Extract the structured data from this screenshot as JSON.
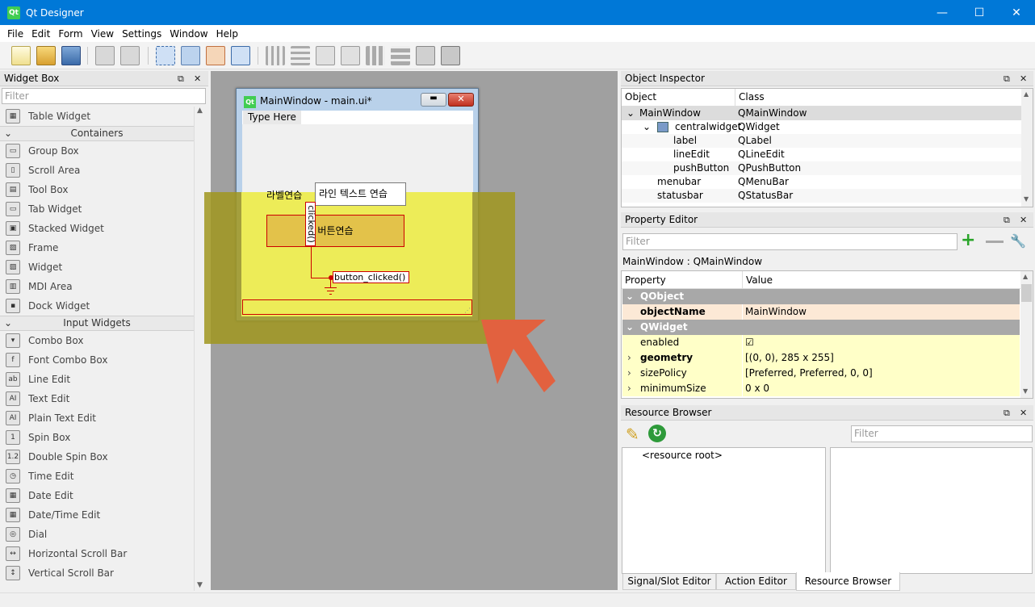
{
  "window": {
    "title": "Qt Designer",
    "app_icon": "Qt",
    "minimize": "—",
    "maximize": "☐",
    "close": "✕"
  },
  "menu": [
    "File",
    "Edit",
    "Form",
    "View",
    "Settings",
    "Window",
    "Help"
  ],
  "toolbar": {
    "icons": [
      "new-file-icon",
      "open-file-icon",
      "save-icon",
      "copy-icon",
      "paste-icon",
      "edit-widgets-icon",
      "edit-signals-slots-icon",
      "edit-buddies-icon",
      "edit-tab-order-icon",
      "layout-horizontal-icon",
      "layout-vertical-icon",
      "layout-h-splitter-icon",
      "layout-v-splitter-icon",
      "layout-grid-icon",
      "layout-form-icon",
      "break-layout-icon",
      "adjust-size-icon"
    ]
  },
  "widget_box": {
    "title": "Widget Box",
    "filter_placeholder": "Filter",
    "items": [
      {
        "type": "item",
        "label": "Table Widget",
        "icon": "▦"
      },
      {
        "type": "cat",
        "label": "Containers"
      },
      {
        "type": "item",
        "label": "Group Box",
        "icon": "▭"
      },
      {
        "type": "item",
        "label": "Scroll Area",
        "icon": "▯"
      },
      {
        "type": "item",
        "label": "Tool Box",
        "icon": "▤"
      },
      {
        "type": "item",
        "label": "Tab Widget",
        "icon": "▭"
      },
      {
        "type": "item",
        "label": "Stacked Widget",
        "icon": "▣"
      },
      {
        "type": "item",
        "label": "Frame",
        "icon": "▨"
      },
      {
        "type": "item",
        "label": "Widget",
        "icon": "▨"
      },
      {
        "type": "item",
        "label": "MDI Area",
        "icon": "▥"
      },
      {
        "type": "item",
        "label": "Dock Widget",
        "icon": "▪"
      },
      {
        "type": "cat",
        "label": "Input Widgets"
      },
      {
        "type": "item",
        "label": "Combo Box",
        "icon": "▾"
      },
      {
        "type": "item",
        "label": "Font Combo Box",
        "icon": "f"
      },
      {
        "type": "item",
        "label": "Line Edit",
        "icon": "ab"
      },
      {
        "type": "item",
        "label": "Text Edit",
        "icon": "AI"
      },
      {
        "type": "item",
        "label": "Plain Text Edit",
        "icon": "AI"
      },
      {
        "type": "item",
        "label": "Spin Box",
        "icon": "1"
      },
      {
        "type": "item",
        "label": "Double Spin Box",
        "icon": "1.2"
      },
      {
        "type": "item",
        "label": "Time Edit",
        "icon": "◷"
      },
      {
        "type": "item",
        "label": "Date Edit",
        "icon": "▦"
      },
      {
        "type": "item",
        "label": "Date/Time Edit",
        "icon": "▦"
      },
      {
        "type": "item",
        "label": "Dial",
        "icon": "◎"
      },
      {
        "type": "item",
        "label": "Horizontal Scroll Bar",
        "icon": "↔"
      },
      {
        "type": "item",
        "label": "Vertical Scroll Bar",
        "icon": "↕"
      }
    ]
  },
  "form": {
    "title": "MainWindow - main.ui*",
    "icon": "Qt",
    "menu_placeholder": "Type Here",
    "label_text": "라벨연습",
    "lineedit_text": "라인 텍스트 연습",
    "button_text": "버튼연습",
    "signal": "clicked()",
    "slot": "button_clicked()"
  },
  "object_inspector": {
    "title": "Object Inspector",
    "col_object": "Object",
    "col_class": "Class",
    "rows": [
      {
        "obj": "MainWindow",
        "cls": "QMainWindow"
      },
      {
        "obj": "centralwidget",
        "cls": "QWidget"
      },
      {
        "obj": "label",
        "cls": "QLabel"
      },
      {
        "obj": "lineEdit",
        "cls": "QLineEdit"
      },
      {
        "obj": "pushButton",
        "cls": "QPushButton"
      },
      {
        "obj": "menubar",
        "cls": "QMenuBar"
      },
      {
        "obj": "statusbar",
        "cls": "QStatusBar"
      }
    ]
  },
  "property_editor": {
    "title": "Property Editor",
    "filter_placeholder": "Filter",
    "context": "MainWindow : QMainWindow",
    "col_property": "Property",
    "col_value": "Value",
    "rows": [
      {
        "k": "QObject",
        "v": "",
        "section": true
      },
      {
        "k": "objectName",
        "v": "MainWindow",
        "bold": true
      },
      {
        "k": "QWidget",
        "v": "",
        "section": true
      },
      {
        "k": "enabled",
        "v": "☑"
      },
      {
        "k": "geometry",
        "v": "[(0, 0), 285 x 255]",
        "bold": true
      },
      {
        "k": "sizePolicy",
        "v": "[Preferred, Preferred, 0, 0]"
      },
      {
        "k": "minimumSize",
        "v": "0 x 0"
      }
    ]
  },
  "resource_browser": {
    "title": "Resource Browser",
    "filter_placeholder": "Filter",
    "root": "<resource root>"
  },
  "bottom_tabs": [
    "Signal/Slot Editor",
    "Action Editor",
    "Resource Browser"
  ],
  "colors": {
    "titlebar": "#0078d7",
    "highlight": "#ffff00",
    "arrow": "#e2613f",
    "connection": "#cc0000"
  }
}
